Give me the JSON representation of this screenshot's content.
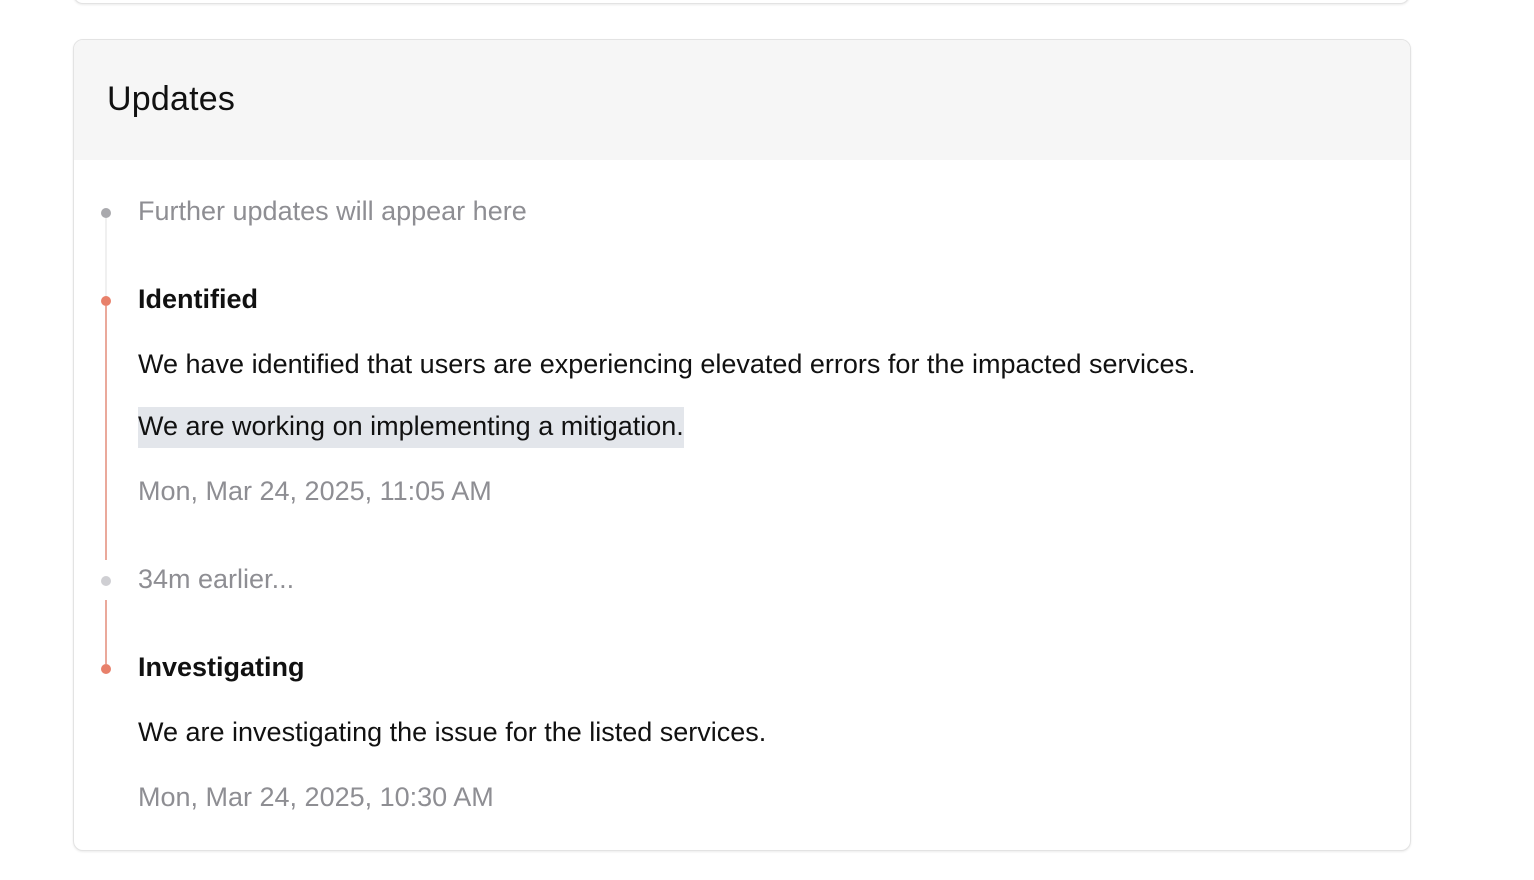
{
  "updates": {
    "title": "Updates",
    "placeholder": "Further updates will appear here",
    "entries": [
      {
        "status": "Identified",
        "paragraphs": [
          "We have identified that users are experiencing elevated errors for the impacted services.",
          "We are working on implementing a mitigation."
        ],
        "timestamp": "Mon, Mar 24, 2025, 11:05 AM"
      },
      {
        "status": "Investigating",
        "paragraphs": [
          "We are investigating the issue for the listed services."
        ],
        "timestamp": "Mon, Mar 24, 2025, 10:30 AM"
      }
    ],
    "gap_label": "34m earlier..."
  },
  "colors": {
    "accent": "#e8806a",
    "accent_line": "#eaa99b",
    "muted_text": "#8e8e93",
    "header_bg": "#f6f6f6",
    "selection_bg": "#e3e6eb"
  }
}
